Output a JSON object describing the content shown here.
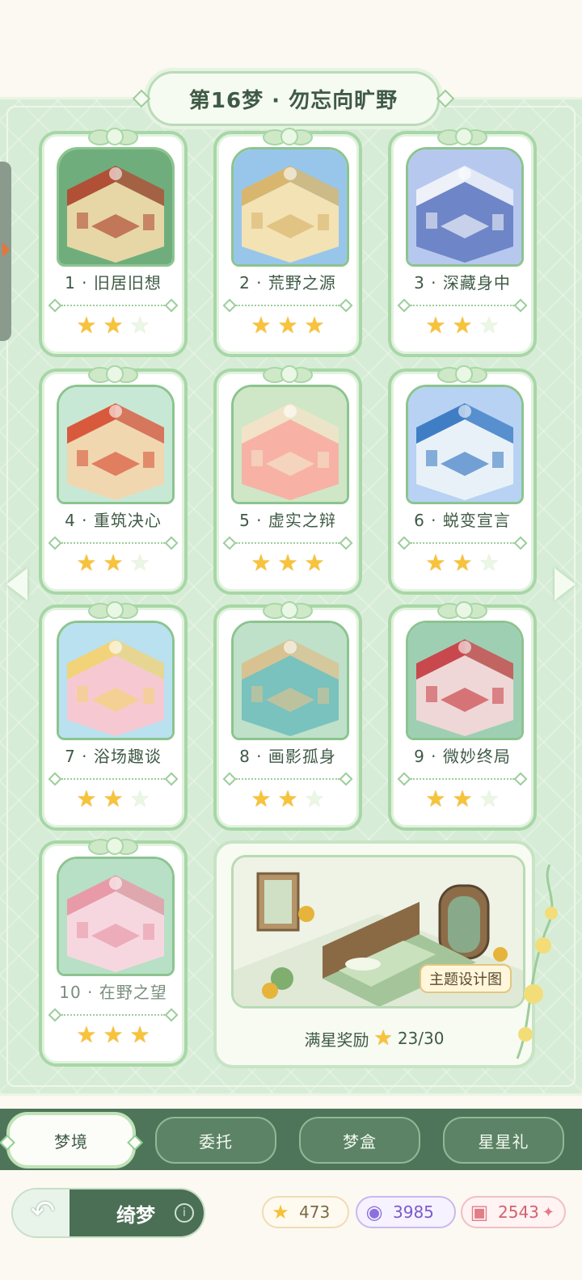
{
  "header": {
    "title": "第16梦 · 勿忘向旷野"
  },
  "levels": [
    {
      "label": "1 · 旧居旧想",
      "stars": 2,
      "max": 3
    },
    {
      "label": "2 · 荒野之源",
      "stars": 3,
      "max": 3
    },
    {
      "label": "3 · 深藏身中",
      "stars": 2,
      "max": 3
    },
    {
      "label": "4 · 重筑决心",
      "stars": 2,
      "max": 3
    },
    {
      "label": "5 · 虚实之辩",
      "stars": 3,
      "max": 3
    },
    {
      "label": "6 · 蜕变宣言",
      "stars": 2,
      "max": 3
    },
    {
      "label": "7 · 浴场趣谈",
      "stars": 2,
      "max": 3
    },
    {
      "label": "8 · 画影孤身",
      "stars": 2,
      "max": 3
    },
    {
      "label": "9 · 微妙终局",
      "stars": 2,
      "max": 3
    },
    {
      "label": "10 · 在野之望",
      "stars": 3,
      "max": 3
    }
  ],
  "reward": {
    "badge": "主题设计图",
    "label": "满星奖励",
    "progress": "23/30"
  },
  "tabs": [
    {
      "label": "梦境",
      "active": true
    },
    {
      "label": "委托",
      "active": false
    },
    {
      "label": "梦盒",
      "active": false
    },
    {
      "label": "星星礼",
      "active": false
    }
  ],
  "footer": {
    "back_label": "绮梦",
    "info_icon": "i",
    "currencies": {
      "stars": "473",
      "gems": "3985",
      "gifts": "2543"
    }
  },
  "icons": {
    "star": "★",
    "back": "↶"
  },
  "colors": {
    "panel": "#d7ecd6",
    "card_border": "#a7d7a6",
    "star_on": "#f7c33b",
    "tabbar": "#4e7559"
  }
}
